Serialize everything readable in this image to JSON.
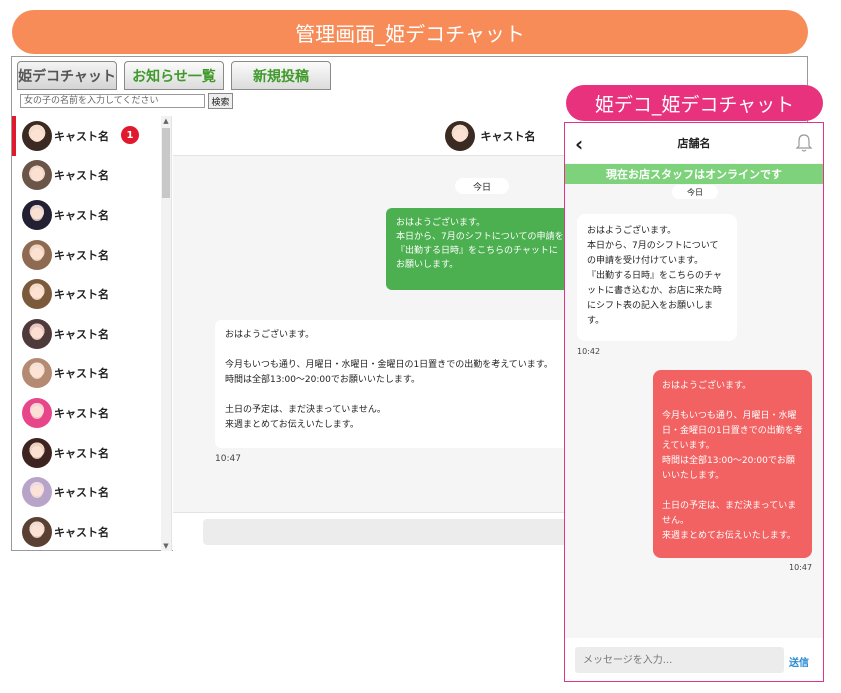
{
  "banner": {
    "title": "管理画面_姫デコチャット"
  },
  "admin": {
    "tabs": [
      {
        "label": "姫デコチャット"
      },
      {
        "label": "お知らせ一覧"
      },
      {
        "label": "新規投稿"
      }
    ],
    "search": {
      "placeholder": "女の子の名前を入力してください",
      "button_label": "検索"
    },
    "cast_list": [
      {
        "name": "キャスト名",
        "badge": "1"
      },
      {
        "name": "キャスト名"
      },
      {
        "name": "キャスト名"
      },
      {
        "name": "キャスト名"
      },
      {
        "name": "キャスト名"
      },
      {
        "name": "キャスト名"
      },
      {
        "name": "キャスト名"
      },
      {
        "name": "キャスト名"
      },
      {
        "name": "キャスト名"
      },
      {
        "name": "キャスト名"
      },
      {
        "name": "キャスト名"
      }
    ],
    "chat": {
      "header_name": "キャスト名",
      "date_label": "今日",
      "shop_message": "おはようございます。\n本日から、7月のシフトについての申請を\n『出勤する日時』をこちらのチャットに\nお願いします。",
      "cast_message": "おはようございます。\n\n今月もいつも通り、月曜日・水曜日・金曜日の1日置きでの出勤を考えています。\n時間は全部13:00～20:00でお願いいたします。\n\n土日の予定は、まだ決まっていません。\n来週まとめてお伝えいたします。",
      "cast_message_time": "10:47"
    }
  },
  "phone": {
    "label": "姫デコ_姫デコチャット",
    "shop_name": "店舗名",
    "online_status": "現在お店スタッフはオンラインです",
    "date_label": "今日",
    "shop_message": "おはようございます。\n本日から、7月のシフトについての申請を受け付けています。\n『出勤する日時』をこちらのチャットに書き込むか、お店に来た時にシフト表の記入をお願いします。",
    "shop_message_time": "10:42",
    "cast_message": "おはようございます。\n\n今月もいつも通り、月曜日・水曜日・金曜日の1日置きでの出勤を考えています。\n時間は全部13:00～20:00でお願いいたします。\n\n土日の予定は、まだ決まっていません。\n来週まとめてお伝えいたします。",
    "cast_message_time": "10:47",
    "input_placeholder": "メッセージを入力...",
    "send_label": "送信"
  },
  "colors": {
    "banner": "#f78c58",
    "phone_label": "#e8327e",
    "online_bar": "#7ed27c",
    "admin_shop_bubble": "#4caf50",
    "phone_cast_bubble": "#f26262",
    "badge": "#e0192e",
    "tab_text_green": "#3f9a2b",
    "send_link": "#2a8ad4"
  }
}
